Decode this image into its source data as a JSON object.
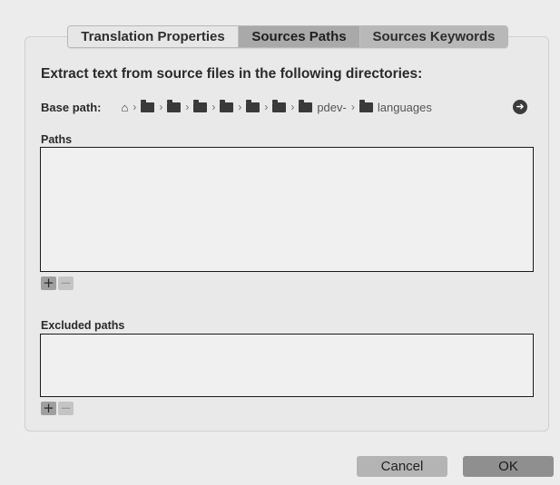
{
  "tabs": [
    {
      "label": "Translation Properties",
      "selected": false
    },
    {
      "label": "Sources Paths",
      "selected": true
    },
    {
      "label": "Sources Keywords",
      "selected": false
    }
  ],
  "heading": "Extract text from source files in the following directories:",
  "base_path": {
    "label": "Base path:",
    "separator": "›",
    "crumbs": [
      {
        "icon": "home-icon",
        "text": ""
      },
      {
        "icon": "folder-icon",
        "text": ""
      },
      {
        "icon": "folder-icon",
        "text": ""
      },
      {
        "icon": "folder-icon",
        "text": ""
      },
      {
        "icon": "folder-icon",
        "text": ""
      },
      {
        "icon": "folder-icon",
        "text": ""
      },
      {
        "icon": "folder-icon",
        "text": ""
      },
      {
        "icon": "folder-icon",
        "text": "pdev-"
      },
      {
        "icon": "folder-icon",
        "text": "languages"
      }
    ],
    "go_icon": "arrow-right-circle-icon"
  },
  "paths": {
    "label": "Paths",
    "items": [],
    "add_label": "+",
    "remove_label": "−"
  },
  "excluded_paths": {
    "label": "Excluded paths",
    "items": [],
    "add_label": "+",
    "remove_label": "−"
  },
  "buttons": {
    "cancel": "Cancel",
    "ok": "OK"
  },
  "colors": {
    "selected_tab": "#a9a9a9",
    "window_bg": "#ececec"
  }
}
